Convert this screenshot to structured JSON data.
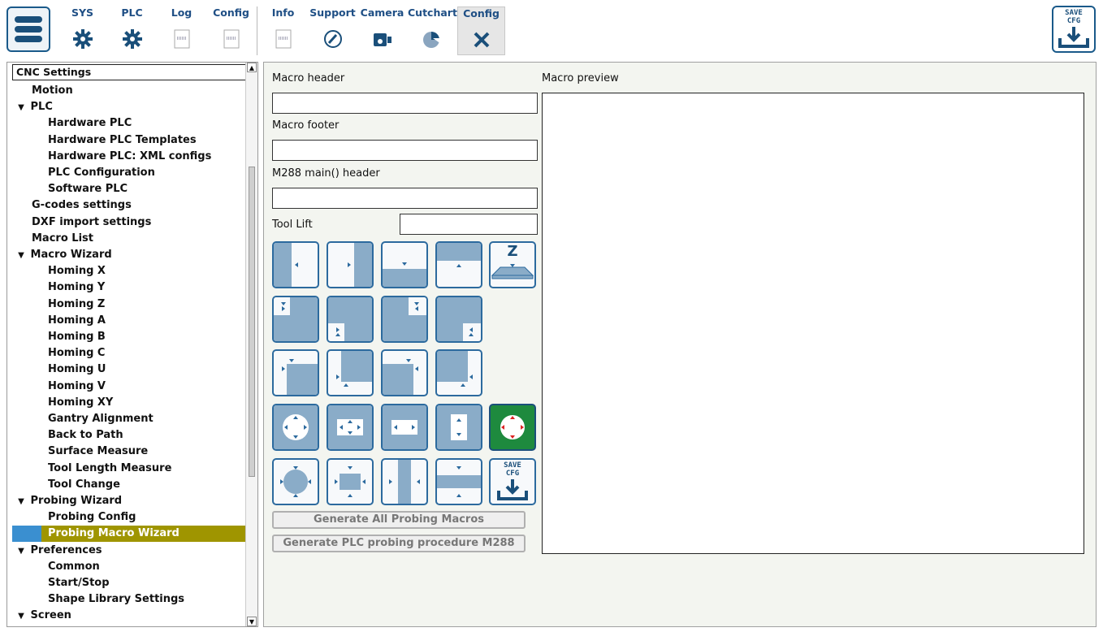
{
  "toolbar": {
    "tabs": [
      {
        "label": "SYS",
        "icon": "gear-icon"
      },
      {
        "label": "PLC",
        "icon": "gear-icon"
      },
      {
        "label": "Log",
        "icon": "log-icon"
      },
      {
        "label": "Config",
        "icon": "log-icon"
      },
      {
        "label": "Info",
        "icon": "log-icon"
      },
      {
        "label": "Support",
        "icon": "phone-icon"
      },
      {
        "label": "Camera",
        "icon": "camera-icon"
      },
      {
        "label": "Cutchart",
        "icon": "pie-chart-icon"
      },
      {
        "label": "Config",
        "icon": "tools-icon"
      }
    ],
    "active_tab": 8,
    "save_label": "SAVE CFG"
  },
  "tree": {
    "header": "CNC Settings",
    "items": [
      {
        "label": "Motion",
        "level": 1,
        "expand": false
      },
      {
        "label": "PLC",
        "level": 0,
        "expand": true
      },
      {
        "label": "Hardware PLC",
        "level": 2,
        "expand": false
      },
      {
        "label": "Hardware PLC Templates",
        "level": 2,
        "expand": false
      },
      {
        "label": "Hardware PLC: XML configs",
        "level": 2,
        "expand": false
      },
      {
        "label": "PLC Configuration",
        "level": 2,
        "expand": false
      },
      {
        "label": "Software PLC",
        "level": 2,
        "expand": false
      },
      {
        "label": "G-codes settings",
        "level": 1,
        "expand": false
      },
      {
        "label": "DXF import settings",
        "level": 1,
        "expand": false
      },
      {
        "label": "Macro List",
        "level": 1,
        "expand": false
      },
      {
        "label": "Macro Wizard",
        "level": 0,
        "expand": true
      },
      {
        "label": "Homing X",
        "level": 2,
        "expand": false
      },
      {
        "label": "Homing Y",
        "level": 2,
        "expand": false
      },
      {
        "label": "Homing Z",
        "level": 2,
        "expand": false
      },
      {
        "label": "Homing A",
        "level": 2,
        "expand": false
      },
      {
        "label": "Homing B",
        "level": 2,
        "expand": false
      },
      {
        "label": "Homing C",
        "level": 2,
        "expand": false
      },
      {
        "label": "Homing U",
        "level": 2,
        "expand": false
      },
      {
        "label": "Homing V",
        "level": 2,
        "expand": false
      },
      {
        "label": "Homing XY",
        "level": 2,
        "expand": false
      },
      {
        "label": "Gantry Alignment",
        "level": 2,
        "expand": false
      },
      {
        "label": "Back to Path",
        "level": 2,
        "expand": false
      },
      {
        "label": "Surface Measure",
        "level": 2,
        "expand": false
      },
      {
        "label": "Tool Length Measure",
        "level": 2,
        "expand": false
      },
      {
        "label": "Tool Change",
        "level": 2,
        "expand": false
      },
      {
        "label": "Probing Wizard",
        "level": 0,
        "expand": true
      },
      {
        "label": "Probing Config",
        "level": 2,
        "expand": false
      },
      {
        "label": "Probing Macro Wizard",
        "level": 2,
        "expand": false,
        "selected": true
      },
      {
        "label": "Preferences",
        "level": 0,
        "expand": true
      },
      {
        "label": "Common",
        "level": 2,
        "expand": false
      },
      {
        "label": "Start/Stop",
        "level": 2,
        "expand": false
      },
      {
        "label": "Shape Library Settings",
        "level": 2,
        "expand": false
      },
      {
        "label": "Screen",
        "level": 0,
        "expand": true
      }
    ]
  },
  "form": {
    "macro_header_label": "Macro header",
    "macro_header_value": "",
    "macro_footer_label": "Macro footer",
    "macro_footer_value": "",
    "m288_label": "M288 main() header",
    "m288_value": "",
    "tool_lift_label": "Tool Lift",
    "tool_lift_value": "",
    "preview_label": "Macro preview",
    "generate_all_label": "Generate All Probing Macros",
    "generate_plc_label": "Generate PLC probing procedure M288",
    "save_label": "SAVE CFG",
    "z_label": "Z"
  },
  "colors": {
    "accent": "#2c6a9e",
    "block": "#8aacc8",
    "selected": "#9f9500",
    "active_probe": "#1e8a3e"
  }
}
